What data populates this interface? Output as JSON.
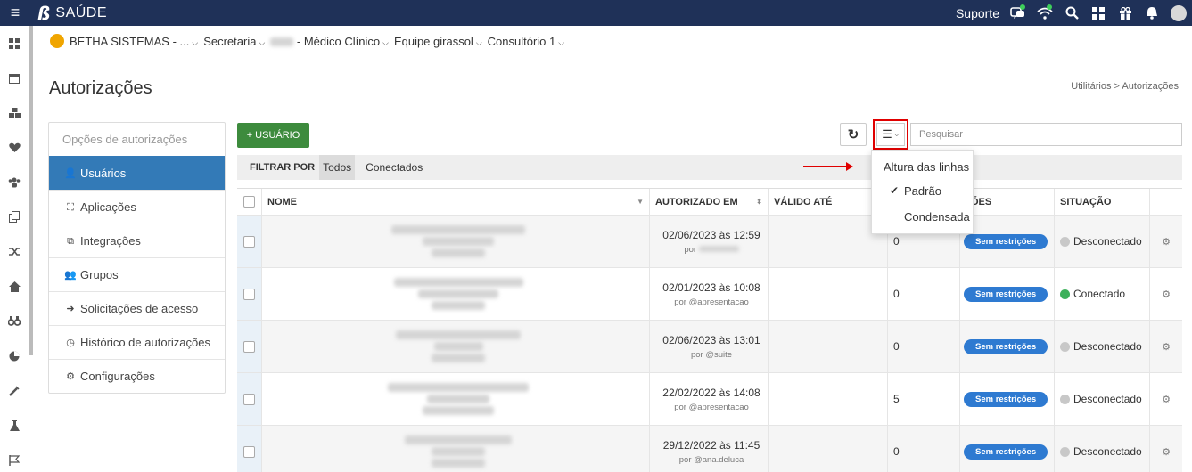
{
  "app": {
    "name": "SAÚDE",
    "support_label": "Suporte"
  },
  "context": {
    "entity": "BETHA SISTEMAS - ...",
    "department": "Secretaria",
    "unit_suffix": "- Médico Clínico",
    "team": "Equipe girassol",
    "office": "Consultório 1"
  },
  "page": {
    "title": "Autorizações",
    "breadcrumb": "Utilitários  >  Autorizações"
  },
  "options": {
    "header": "Opções de autorizações",
    "items": [
      {
        "label": "Usuários",
        "icon": "user-icon",
        "glyph": "👤"
      },
      {
        "label": "Aplicações",
        "icon": "sitemap-icon",
        "glyph": "⛶"
      },
      {
        "label": "Integrações",
        "icon": "puzzle-icon",
        "glyph": "⧉"
      },
      {
        "label": "Grupos",
        "icon": "group-icon",
        "glyph": "👥"
      },
      {
        "label": "Solicitações de acesso",
        "icon": "sign-in-icon",
        "glyph": "➜"
      },
      {
        "label": "Histórico de autorizações",
        "icon": "history-icon",
        "glyph": "◷"
      },
      {
        "label": "Configurações",
        "icon": "gears-icon",
        "glyph": "⚙"
      }
    ]
  },
  "toolbar": {
    "add_label": "+ USUÁRIO",
    "search_placeholder": "Pesquisar"
  },
  "filter": {
    "label": "FILTRAR POR",
    "options": [
      "Todos",
      "Conectados"
    ],
    "selected": "Todos"
  },
  "table": {
    "columns": [
      "NOME",
      "AUTORIZADO EM",
      "VÁLIDO ATÉ",
      "",
      "ÇÕES",
      "SITUAÇÃO"
    ],
    "rows": [
      {
        "date": "02/06/2023 às 12:59",
        "by": "por",
        "count": "0",
        "restriction": "Sem restrições",
        "status": "Desconectado",
        "status_color": "#c8c8c8"
      },
      {
        "date": "02/01/2023 às 10:08",
        "by": "por @apresentacao",
        "count": "0",
        "restriction": "Sem restrições",
        "status": "Conectado",
        "status_color": "#3cb05a"
      },
      {
        "date": "02/06/2023 às 13:01",
        "by": "por @suite",
        "count": "0",
        "restriction": "Sem restrições",
        "status": "Desconectado",
        "status_color": "#c8c8c8"
      },
      {
        "date": "22/02/2022 às 14:08",
        "by": "por @apresentacao",
        "count": "5",
        "restriction": "Sem restrições",
        "status": "Desconectado",
        "status_color": "#c8c8c8"
      },
      {
        "date": "29/12/2022 às 11:45",
        "by": "por @ana.deluca",
        "count": "0",
        "restriction": "Sem restrições",
        "status": "Desconectado",
        "status_color": "#c8c8c8"
      }
    ]
  },
  "density_menu": {
    "title": "Altura das linhas",
    "options": [
      "Padrão",
      "Condensada"
    ],
    "selected": "Padrão"
  },
  "colors": {
    "topbar": "#1f3158",
    "primary": "#337ab7",
    "success": "#3d8b3d",
    "highlight": "#e00000"
  }
}
